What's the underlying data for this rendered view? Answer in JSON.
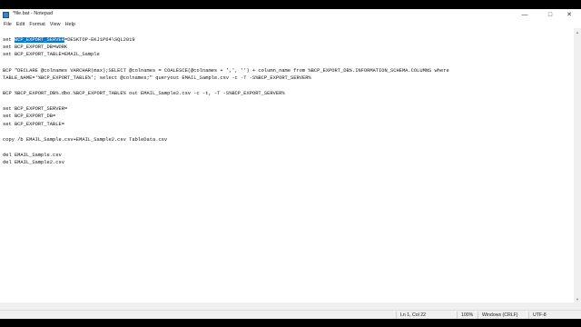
{
  "window": {
    "title": "*file.bat - Notepad",
    "minimize_glyph": "—",
    "maximize_glyph": "□",
    "close_glyph": "✕"
  },
  "menu": [
    "File",
    "Edit",
    "Format",
    "View",
    "Help"
  ],
  "editor": {
    "line1_prefix": "set ",
    "line1_selected": "BCP_EXPORT_SERVER",
    "line1_rest": "=DESKTOP-EKJ1P64\\SQL2019",
    "lines": [
      "set BCP_EXPORT_DB=WORK",
      "set BCP_EXPORT_TABLE=EMAIL_Sample",
      "",
      "BCP \"DECLARE @colnames VARCHAR(max);SELECT @colnames = COALESCE(@colnames + ',', '') + column_name from %BCP_EXPORT_DB%.INFORMATION_SCHEMA.COLUMNS where",
      "TABLE_NAME='%BCP_EXPORT_TABLE%'; select @colnames;\" queryout EMAIL_Sample.csv -c -T -S%BCP_EXPORT_SERVER%",
      "",
      "BCP %BCP_EXPORT_DB%.dbo.%BCP_EXPORT_TABLE% out EMAIL_Sample2.csv -c -t, -T -S%BCP_EXPORT_SERVER%",
      "",
      "set BCP_EXPORT_SERVER=",
      "set BCP_EXPORT_DB=",
      "set BCP_EXPORT_TABLE=",
      "",
      "copy /b EMAIL_Sample.csv+EMAIL_Sample2.csv TableData.csv",
      "",
      "del EMAIL_Sample.csv",
      "del EMAIL_Sample2.csv"
    ]
  },
  "status": {
    "position": "Ln 1, Col 22",
    "zoom": "100%",
    "line_endings": "Windows (CRLF)",
    "encoding": "UTF-8"
  },
  "colors": {
    "selection": "#0078d7",
    "statusbar": "#f0f0f0"
  }
}
